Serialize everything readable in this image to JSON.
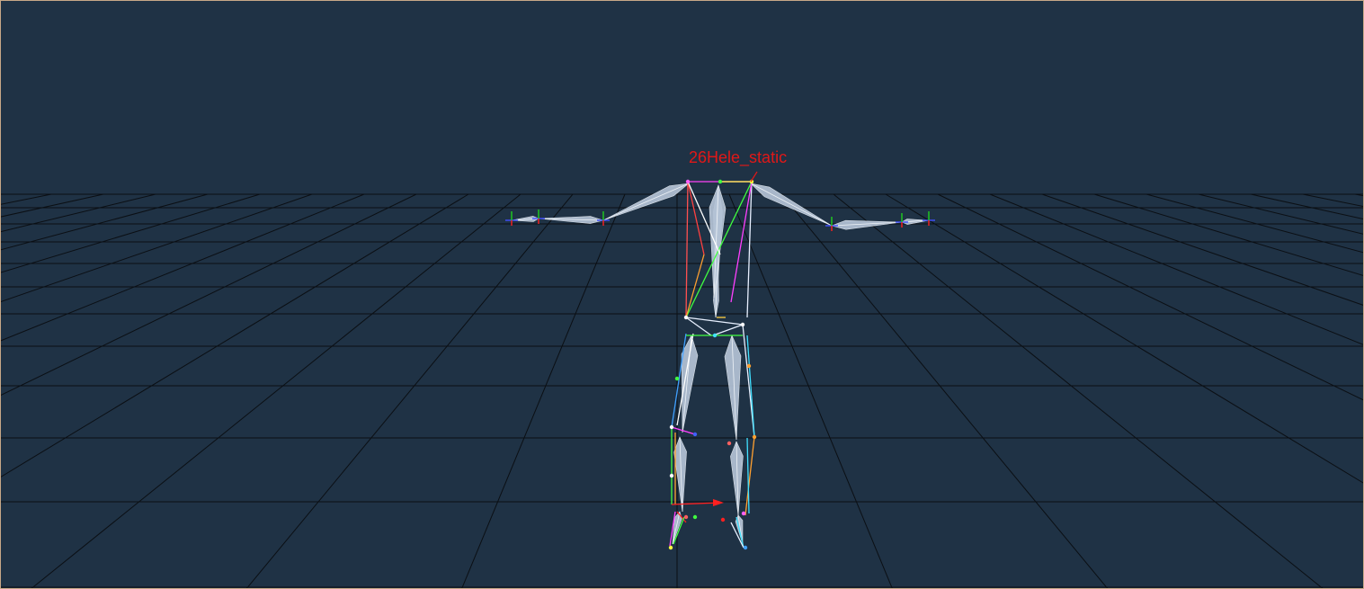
{
  "viewport": {
    "subject_label": "26Hele_static",
    "label_color": "#e01818",
    "background_color": "#1f3245",
    "grid_color": "#0b0f14",
    "bone_color": "#b4c3d6"
  }
}
